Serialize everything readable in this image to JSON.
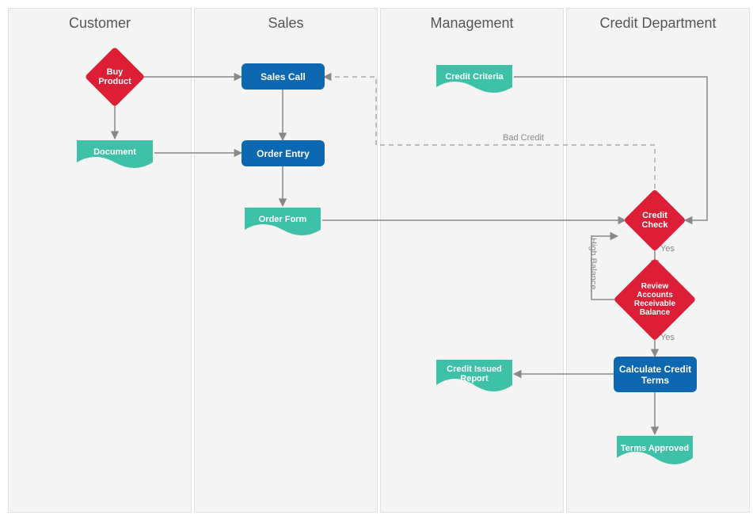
{
  "lanes": {
    "customer": "Customer",
    "sales": "Sales",
    "management": "Management",
    "credit": "Credit Department"
  },
  "nodes": {
    "buy_product": "Buy Product",
    "document": "Document",
    "sales_call": "Sales Call",
    "order_entry": "Order Entry",
    "order_form": "Order Form",
    "credit_criteria": "Credit Criteria",
    "credit_check": "Credit Check",
    "review_ar": "Review Accounts Receivable Balance",
    "calculate_terms": "Calculate Credit Terms",
    "credit_issued_report": "Credit Issued Report",
    "terms_approved": "Terms Approved"
  },
  "edge_labels": {
    "bad_credit": "Bad Credit",
    "high_balance": "High Balance",
    "yes1": "Yes",
    "yes2": "Yes"
  },
  "chart_data": {
    "type": "flowchart-swimlane",
    "lanes": [
      "Customer",
      "Sales",
      "Management",
      "Credit Department"
    ],
    "nodes": [
      {
        "id": "buy_product",
        "label": "Buy Product",
        "lane": "Customer",
        "shape": "decision"
      },
      {
        "id": "document",
        "label": "Document",
        "lane": "Customer",
        "shape": "document"
      },
      {
        "id": "sales_call",
        "label": "Sales Call",
        "lane": "Sales",
        "shape": "process"
      },
      {
        "id": "order_entry",
        "label": "Order Entry",
        "lane": "Sales",
        "shape": "process"
      },
      {
        "id": "order_form",
        "label": "Order Form",
        "lane": "Sales",
        "shape": "document"
      },
      {
        "id": "credit_criteria",
        "label": "Credit Criteria",
        "lane": "Management",
        "shape": "document"
      },
      {
        "id": "credit_check",
        "label": "Credit Check",
        "lane": "Credit Department",
        "shape": "decision"
      },
      {
        "id": "review_ar",
        "label": "Review Accounts Receivable Balance",
        "lane": "Credit Department",
        "shape": "decision"
      },
      {
        "id": "calculate_terms",
        "label": "Calculate Credit Terms",
        "lane": "Credit Department",
        "shape": "process"
      },
      {
        "id": "credit_issued_report",
        "label": "Credit Issued Report",
        "lane": "Management",
        "shape": "document"
      },
      {
        "id": "terms_approved",
        "label": "Terms Approved",
        "lane": "Credit Department",
        "shape": "document"
      }
    ],
    "edges": [
      {
        "from": "buy_product",
        "to": "document"
      },
      {
        "from": "buy_product",
        "to": "sales_call"
      },
      {
        "from": "document",
        "to": "order_entry"
      },
      {
        "from": "sales_call",
        "to": "order_entry"
      },
      {
        "from": "order_entry",
        "to": "order_form"
      },
      {
        "from": "order_form",
        "to": "credit_check"
      },
      {
        "from": "credit_criteria",
        "to": "credit_check"
      },
      {
        "from": "credit_check",
        "to": "sales_call",
        "label": "Bad Credit",
        "style": "dashed"
      },
      {
        "from": "credit_check",
        "to": "review_ar",
        "label": "Yes"
      },
      {
        "from": "review_ar",
        "to": "credit_check",
        "label": "High Balance"
      },
      {
        "from": "review_ar",
        "to": "calculate_terms",
        "label": "Yes"
      },
      {
        "from": "calculate_terms",
        "to": "credit_issued_report"
      },
      {
        "from": "calculate_terms",
        "to": "terms_approved"
      }
    ]
  }
}
